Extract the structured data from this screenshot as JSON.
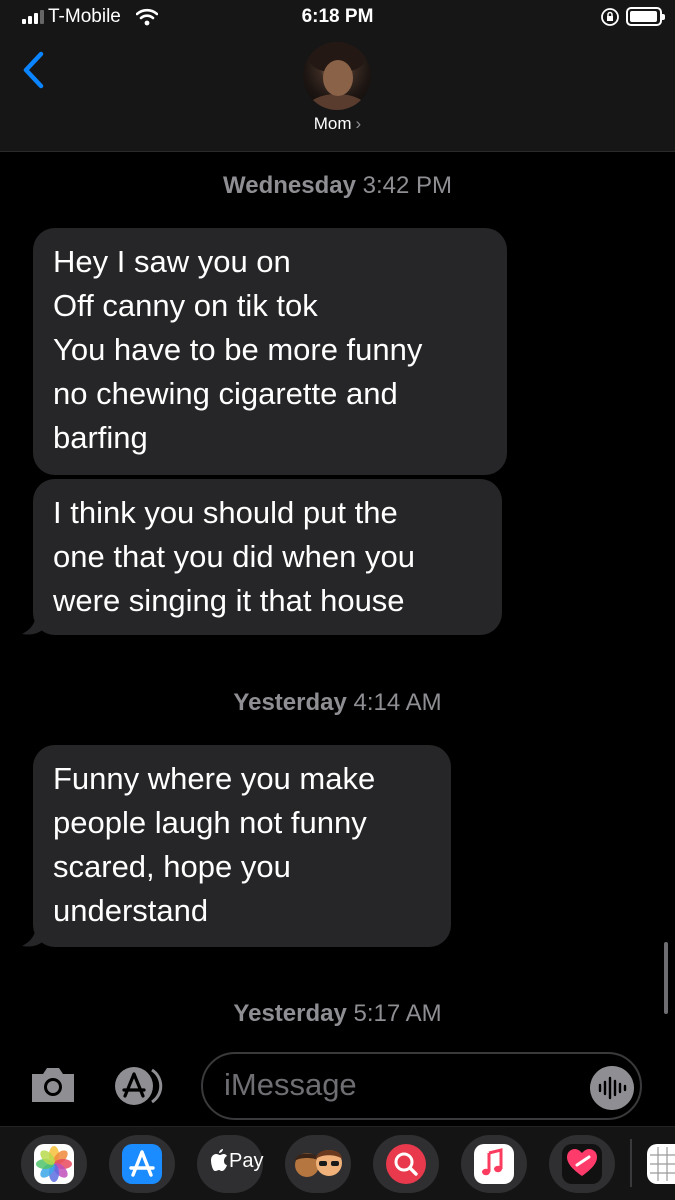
{
  "status_bar": {
    "carrier": "T-Mobile",
    "time": "6:18 PM"
  },
  "header": {
    "contact_name": "Mom",
    "chevron": "›"
  },
  "messages": [
    {
      "type": "timestamp",
      "day": "Wednesday",
      "time": "3:42 PM"
    },
    {
      "type": "received",
      "lines": [
        "Hey I saw you on",
        "Off canny on tik tok",
        "You have to be more funny",
        "no chewing cigarette and",
        "barfing"
      ]
    },
    {
      "type": "received",
      "lines": [
        "I think you should put the",
        "one that you did when you",
        "were singing it that house"
      ]
    },
    {
      "type": "timestamp",
      "day": "Yesterday",
      "time": "4:14 AM"
    },
    {
      "type": "received",
      "lines": [
        "Funny where you make",
        "people laugh not funny",
        "scared, hope you",
        "understand"
      ]
    },
    {
      "type": "timestamp",
      "day": "Yesterday",
      "time": "5:17 AM"
    }
  ],
  "compose": {
    "placeholder": "iMessage"
  },
  "app_drawer": {
    "apple_pay_label": "Pay",
    "apps": [
      "photos-icon",
      "app-store-icon",
      "apple-pay-icon",
      "memoji-icon",
      "web-search-icon",
      "music-icon",
      "digital-touch-icon",
      "more-apps-icon"
    ]
  },
  "colors": {
    "background": "#000000",
    "bubble": "#262628",
    "timestamp": "#8e8e93",
    "accent": "#0a84ff"
  }
}
